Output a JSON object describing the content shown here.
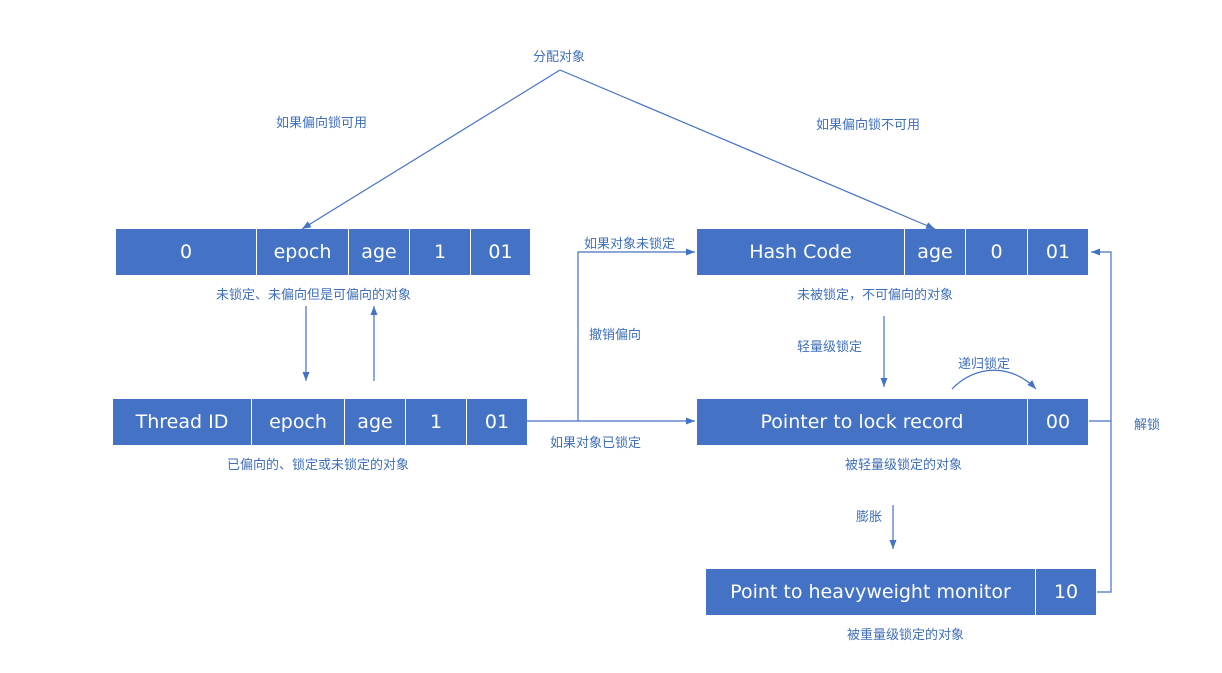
{
  "labels": {
    "allocate": "分配对象",
    "biasable": "如果偏向锁可用",
    "not_biasable": "如果偏向锁不可用",
    "if_unlocked": "如果对象未锁定",
    "revoke_bias": "撤销偏向",
    "if_locked": "如果对象已锁定",
    "lightweight_lock": "轻量级锁定",
    "recursive_lock": "递归锁定",
    "unlock": "解锁",
    "inflate": "膨胀"
  },
  "boxes": {
    "anon_biased": {
      "cells": [
        "0",
        "epoch",
        "age",
        "1",
        "01"
      ],
      "caption": "未锁定、未偏向但是可偏向的对象"
    },
    "biased": {
      "cells": [
        "Thread ID",
        "epoch",
        "age",
        "1",
        "01"
      ],
      "caption": "已偏向的、锁定或未锁定的对象"
    },
    "unbiasable": {
      "cells": [
        "Hash Code",
        "age",
        "0",
        "01"
      ],
      "caption": "未被锁定，不可偏向的对象"
    },
    "lightweight": {
      "cells": [
        "Pointer to lock record",
        "00"
      ],
      "caption": "被轻量级锁定的对象"
    },
    "heavyweight": {
      "cells": [
        "Point to heavyweight monitor",
        "10"
      ],
      "caption": "被重量级锁定的对象"
    }
  },
  "colors": {
    "box_fill": "#4472c4",
    "line": "#4472c4",
    "text": "#3f6fb8"
  }
}
